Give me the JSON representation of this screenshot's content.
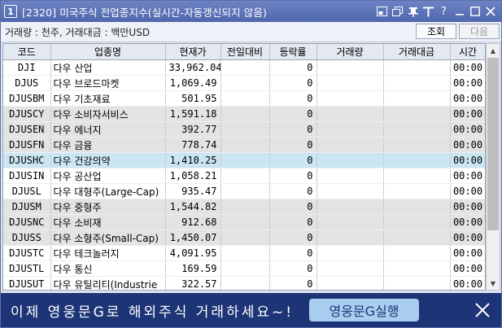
{
  "window": {
    "number": "1",
    "title": "[2320] 미국주식 전업종지수(실시간-자동갱신되지 않음)",
    "icons": [
      "window-restore-icon",
      "copy-icon",
      "pin-icon",
      "text-size-icon",
      "help-icon",
      "minimize-icon",
      "maximize-icon",
      "close-icon"
    ]
  },
  "toolbar": {
    "caption": "거래량 : 천주, 거래대금 : 백만USD",
    "query_label": "조회",
    "next_label": "다음"
  },
  "table": {
    "columns": [
      "코드",
      "업종명",
      "현재가",
      "전일대비",
      "등락률",
      "거래량",
      "거래대금",
      "시간"
    ],
    "rows": [
      {
        "code": "DJI",
        "name": "다우 산업",
        "price": "33,962.04",
        "change": "",
        "rate": "0",
        "volume": "",
        "amount": "",
        "time": "00:00",
        "style": "white"
      },
      {
        "code": "DJUS",
        "name": "다우 브로드마켓",
        "price": "1,069.49",
        "change": "",
        "rate": "0",
        "volume": "",
        "amount": "",
        "time": "00:00",
        "style": "white"
      },
      {
        "code": "DJUSBM",
        "name": "다우 기초재료",
        "price": "501.95",
        "change": "",
        "rate": "0",
        "volume": "",
        "amount": "",
        "time": "00:00",
        "style": "white"
      },
      {
        "code": "DJUSCY",
        "name": "다우 소비자서비스",
        "price": "1,591.18",
        "change": "",
        "rate": "0",
        "volume": "",
        "amount": "",
        "time": "00:00",
        "style": "grey"
      },
      {
        "code": "DJUSEN",
        "name": "다우 에너지",
        "price": "392.77",
        "change": "",
        "rate": "0",
        "volume": "",
        "amount": "",
        "time": "00:00",
        "style": "grey"
      },
      {
        "code": "DJUSFN",
        "name": "다우 금융",
        "price": "778.74",
        "change": "",
        "rate": "0",
        "volume": "",
        "amount": "",
        "time": "00:00",
        "style": "grey"
      },
      {
        "code": "DJUSHC",
        "name": "다우 건강의약",
        "price": "1,410.25",
        "change": "",
        "rate": "0",
        "volume": "",
        "amount": "",
        "time": "00:00",
        "style": "sel"
      },
      {
        "code": "DJUSIN",
        "name": "다우 공산업",
        "price": "1,058.21",
        "change": "",
        "rate": "0",
        "volume": "",
        "amount": "",
        "time": "00:00",
        "style": "white"
      },
      {
        "code": "DJUSL",
        "name": "다우 대형주(Large-Cap)",
        "price": "935.47",
        "change": "",
        "rate": "0",
        "volume": "",
        "amount": "",
        "time": "00:00",
        "style": "white"
      },
      {
        "code": "DJUSM",
        "name": "다우 중형주",
        "price": "1,544.82",
        "change": "",
        "rate": "0",
        "volume": "",
        "amount": "",
        "time": "00:00",
        "style": "grey"
      },
      {
        "code": "DJUSNC",
        "name": "다우 소비재",
        "price": "912.68",
        "change": "",
        "rate": "0",
        "volume": "",
        "amount": "",
        "time": "00:00",
        "style": "grey"
      },
      {
        "code": "DJUSS",
        "name": "다우 소형주(Small-Cap)",
        "price": "1,450.07",
        "change": "",
        "rate": "0",
        "volume": "",
        "amount": "",
        "time": "00:00",
        "style": "grey"
      },
      {
        "code": "DJUSTC",
        "name": "다우 테크놀러지",
        "price": "4,091.95",
        "change": "",
        "rate": "0",
        "volume": "",
        "amount": "",
        "time": "00:00",
        "style": "white"
      },
      {
        "code": "DJUSTL",
        "name": "다우 통신",
        "price": "169.59",
        "change": "",
        "rate": "0",
        "volume": "",
        "amount": "",
        "time": "00:00",
        "style": "white"
      },
      {
        "code": "DJUSUT",
        "name": "다우 유틸리티(Industrie",
        "price": "322.57",
        "change": "",
        "rate": "0",
        "volume": "",
        "amount": "",
        "time": "00:00",
        "style": "white"
      }
    ]
  },
  "banner": {
    "message": "이제 영웅문G로 해외주식 거래하세요~!",
    "cta_label": "영웅문G실행"
  },
  "colors": {
    "titlebar": "#5a71b6",
    "banner": "#1d3577",
    "cta": "#a9cdee",
    "selected_row": "#cbe6f3",
    "grey_row": "#e3e3e3"
  }
}
